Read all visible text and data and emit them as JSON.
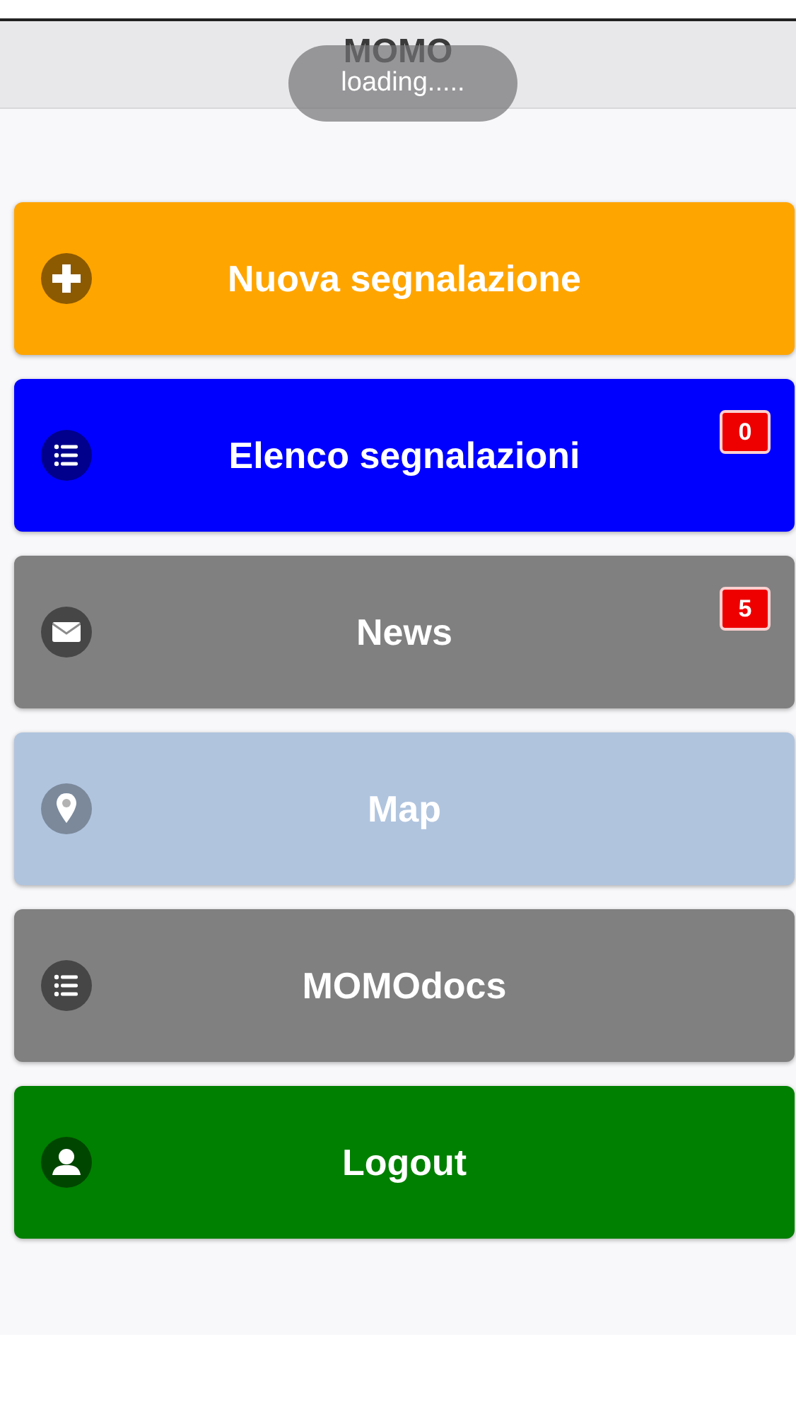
{
  "header": {
    "title": "MOMO"
  },
  "toast": {
    "text": "loading....."
  },
  "menu": [
    {
      "label": "Nuova segnalazione",
      "kind": "plus",
      "color": "#ffa500"
    },
    {
      "label": "Elenco segnalazioni",
      "kind": "list",
      "color": "#0000ff",
      "badge": "0"
    },
    {
      "label": "News",
      "kind": "mail",
      "color": "#808080",
      "badge": "5"
    },
    {
      "label": "Map",
      "kind": "pin",
      "color": "#b0c4de"
    },
    {
      "label": "MOMOdocs",
      "kind": "list",
      "color": "#808080"
    },
    {
      "label": "Logout",
      "kind": "user",
      "color": "#008000"
    }
  ]
}
